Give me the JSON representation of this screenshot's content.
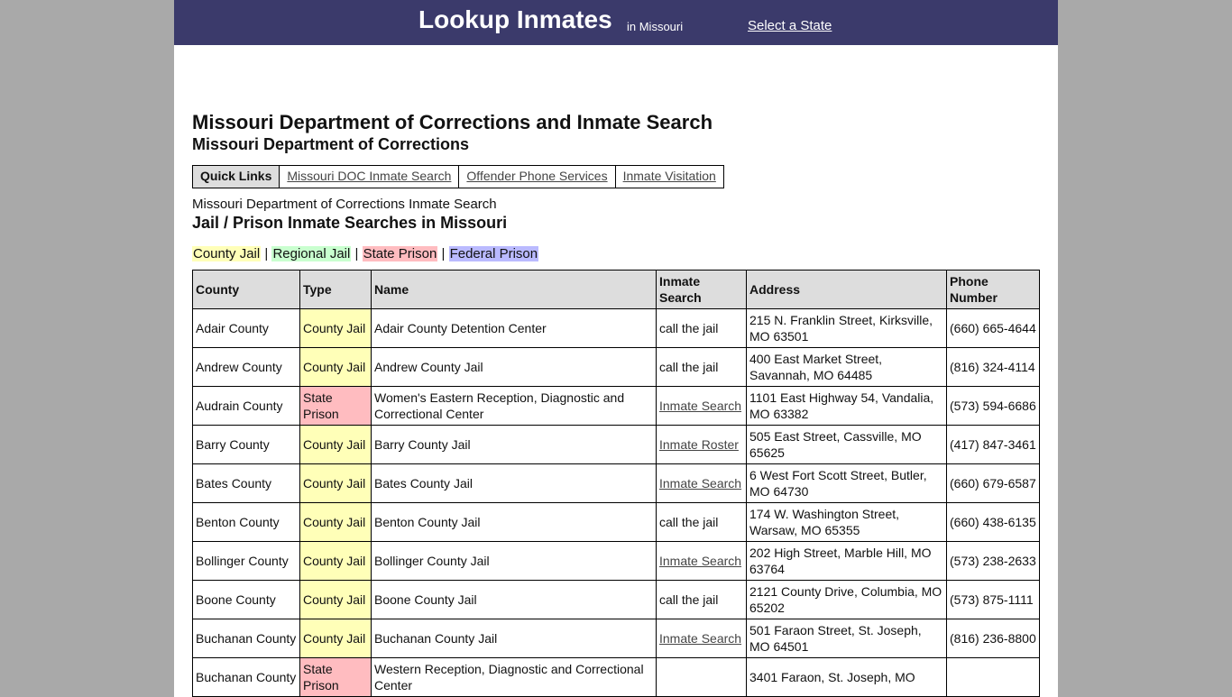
{
  "header": {
    "brand": "Lookup Inmates",
    "state_sub": "in Missouri",
    "select_state_link": "Select a State"
  },
  "page_title": "Missouri Department of Corrections and Inmate Search",
  "doc_section": {
    "title": "Missouri Department of Corrections",
    "quick_links_label": "Quick Links",
    "quick_links": [
      "Missouri DOC Inmate Search",
      "Offender Phone Services",
      "Inmate Visitation"
    ],
    "description": "Missouri Department of Corrections Inmate Search"
  },
  "jail_section": {
    "title": "Jail / Prison Inmate Searches in Missouri",
    "legend": {
      "county_jail": "County Jail",
      "regional_jail": "Regional Jail",
      "state_prison": "State Prison",
      "federal_prison": "Federal Prison",
      "separator": "|"
    },
    "type_colors": {
      "county_jail": "#ffffb8",
      "regional_jail": "#c9ffcf",
      "state_prison": "#ffbcc0",
      "federal_prison": "#babaff"
    },
    "columns": [
      "County",
      "Type",
      "Name",
      "Inmate Search",
      "Address",
      "Phone Number"
    ],
    "rows": [
      {
        "county": "Adair County",
        "type": "County Jail",
        "type_key": "county",
        "name": "Adair County Detention Center",
        "search": "call the jail",
        "search_is_link": false,
        "address": "215 N. Franklin Street, Kirksville, MO 63501",
        "phone": "(660) 665-4644"
      },
      {
        "county": "Andrew County",
        "type": "County Jail",
        "type_key": "county",
        "name": "Andrew County Jail",
        "search": "call the jail",
        "search_is_link": false,
        "address": "400 East Market Street, Savannah, MO 64485",
        "phone": "(816) 324-4114"
      },
      {
        "county": "Audrain County",
        "type": "State Prison",
        "type_key": "state",
        "name": "Women's Eastern Reception, Diagnostic and Correctional Center",
        "search": "Inmate Search",
        "search_is_link": true,
        "address": "1101 East Highway 54, Vandalia, MO 63382",
        "phone": "(573) 594-6686"
      },
      {
        "county": "Barry County",
        "type": "County Jail",
        "type_key": "county",
        "name": "Barry County Jail",
        "search": "Inmate Roster",
        "search_is_link": true,
        "address": "505 East Street, Cassville, MO 65625",
        "phone": "(417) 847-3461"
      },
      {
        "county": "Bates County",
        "type": "County Jail",
        "type_key": "county",
        "name": "Bates County Jail",
        "search": "Inmate Search",
        "search_is_link": true,
        "address": "6 West Fort Scott Street, Butler, MO 64730",
        "phone": "(660) 679-6587"
      },
      {
        "county": "Benton County",
        "type": "County Jail",
        "type_key": "county",
        "name": "Benton County Jail",
        "search": "call the jail",
        "search_is_link": false,
        "address": "174 W. Washington Street, Warsaw, MO 65355",
        "phone": "(660) 438-6135"
      },
      {
        "county": "Bollinger County",
        "type": "County Jail",
        "type_key": "county",
        "name": "Bollinger County Jail",
        "search": "Inmate Search",
        "search_is_link": true,
        "address": "202 High Street, Marble Hill, MO 63764",
        "phone": "(573) 238-2633"
      },
      {
        "county": "Boone County",
        "type": "County Jail",
        "type_key": "county",
        "name": "Boone County Jail",
        "search": "call the jail",
        "search_is_link": false,
        "address": "2121 County Drive, Columbia, MO 65202",
        "phone": "(573) 875-1111"
      },
      {
        "county": "Buchanan County",
        "type": "County Jail",
        "type_key": "county",
        "name": "Buchanan County Jail",
        "search": "Inmate Search",
        "search_is_link": true,
        "address": "501 Faraon Street, St. Joseph, MO 64501",
        "phone": "(816) 236-8800"
      },
      {
        "county": "Buchanan County",
        "type": "State Prison",
        "type_key": "state",
        "name": "Western Reception, Diagnostic and Correctional Center",
        "search": "",
        "search_is_link": false,
        "address": "3401 Faraon, St. Joseph, MO",
        "phone": ""
      }
    ]
  }
}
